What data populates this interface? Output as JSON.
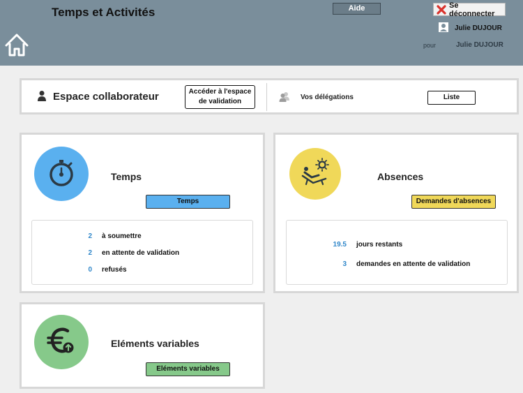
{
  "header": {
    "title": "Temps et Activités",
    "help_label": "Aide",
    "logout_label": "Se déconnecter",
    "user_name": "Julie DUJOUR",
    "for_label": "pour",
    "for_name": "Julie DUJOUR"
  },
  "collaborateur": {
    "title": "Espace collaborateur",
    "validation_button": "Accéder à l'espace de validation",
    "delegations_label": "Vos délégations",
    "list_button": "Liste"
  },
  "temps": {
    "title": "Temps",
    "button": "Temps",
    "button_color": "#5ab0ef",
    "circle_color": "#5ab0ef",
    "stats": [
      {
        "value": "2",
        "label": "à soumettre"
      },
      {
        "value": "2",
        "label": "en attente de validation"
      },
      {
        "value": "0",
        "label": "refusés"
      }
    ]
  },
  "absences": {
    "title": "Absences",
    "button": "Demandes d'absences",
    "button_color": "#f0d859",
    "circle_color": "#f0d859",
    "stats": [
      {
        "value": "19.5",
        "label": "jours restants"
      },
      {
        "value": "3",
        "label": "demandes en attente de validation"
      }
    ]
  },
  "variables": {
    "title": "Eléments variables",
    "button": "Eléments variables",
    "button_color": "#86c98a",
    "circle_color": "#86c98a"
  },
  "icons": {
    "home": "home-icon",
    "logout": "close-x-icon",
    "user": "user-icon",
    "delegations": "users-icon",
    "temps": "stopwatch-icon",
    "absences": "sunbed-icon",
    "variables": "euro-icon"
  }
}
